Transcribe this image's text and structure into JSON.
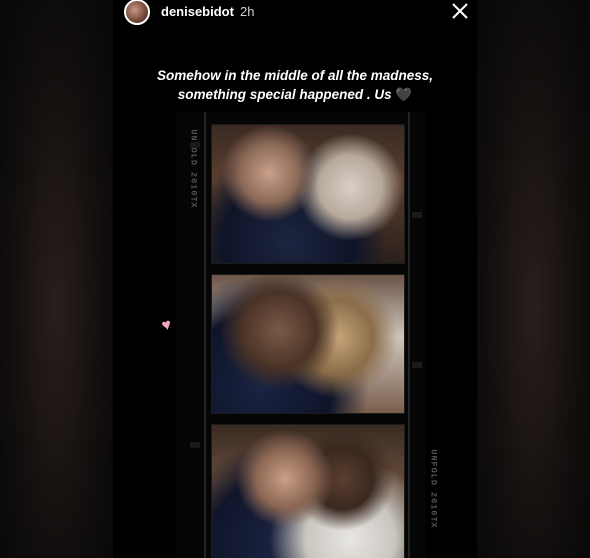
{
  "story": {
    "username": "denisebidot",
    "time": "2h",
    "caption_line1": "Somehow in the middle of all the madness,",
    "caption_line2": "something special happened . Us",
    "caption_emoji": "🖤",
    "film_edge_text_top": "UNFOLD 2010TX",
    "film_edge_text_bottom": "UNFOLD 2010TX",
    "sticker": "♥"
  },
  "icons": {
    "close": "close-icon",
    "heart": "heart-icon"
  },
  "colors": {
    "background": "#000000",
    "text": "#ffffff",
    "sticker": "#f2a7bd"
  }
}
